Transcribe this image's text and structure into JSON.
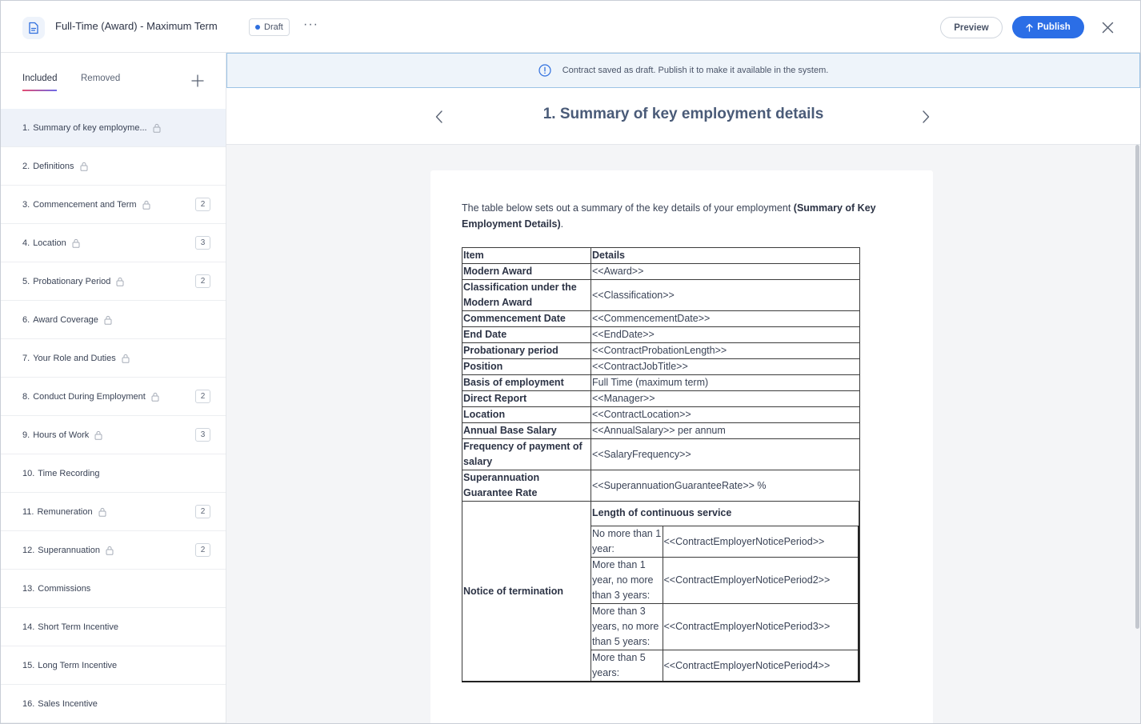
{
  "header": {
    "title": "Full-Time (Award) - Maximum Term",
    "status": "Draft",
    "more": "···",
    "preview_label": "Preview",
    "publish_label": "Publish"
  },
  "sidebar": {
    "tabs": [
      "Included",
      "Removed"
    ],
    "items": [
      {
        "num": "1.",
        "label": "Summary of key employme...",
        "lock": true,
        "count": ""
      },
      {
        "num": "2.",
        "label": "Definitions",
        "lock": true,
        "count": ""
      },
      {
        "num": "3.",
        "label": "Commencement and Term",
        "lock": true,
        "count": "2"
      },
      {
        "num": "4.",
        "label": "Location",
        "lock": true,
        "count": "3"
      },
      {
        "num": "5.",
        "label": "Probationary Period",
        "lock": true,
        "count": "2"
      },
      {
        "num": "6.",
        "label": "Award Coverage",
        "lock": true,
        "count": ""
      },
      {
        "num": "7.",
        "label": "Your Role and Duties",
        "lock": true,
        "count": ""
      },
      {
        "num": "8.",
        "label": "Conduct During Employment",
        "lock": true,
        "count": "2"
      },
      {
        "num": "9.",
        "label": "Hours of Work",
        "lock": true,
        "count": "3"
      },
      {
        "num": "10.",
        "label": "Time Recording",
        "lock": false,
        "count": ""
      },
      {
        "num": "11.",
        "label": "Remuneration",
        "lock": true,
        "count": "2"
      },
      {
        "num": "12.",
        "label": "Superannuation",
        "lock": true,
        "count": "2"
      },
      {
        "num": "13.",
        "label": "Commissions",
        "lock": false,
        "count": ""
      },
      {
        "num": "14.",
        "label": "Short Term Incentive",
        "lock": false,
        "count": ""
      },
      {
        "num": "15.",
        "label": "Long Term Incentive",
        "lock": false,
        "count": ""
      },
      {
        "num": "16.",
        "label": "Sales Incentive",
        "lock": false,
        "count": ""
      }
    ]
  },
  "banner": {
    "text": "Contract saved as draft. Publish it to make it available in the system."
  },
  "section": {
    "title": "1. Summary of key employment details",
    "intro_text": "The table below sets out a summary of the key details of your employment ",
    "intro_bold": "(Summary of Key Employment Details)",
    "intro_end": "."
  },
  "table": {
    "header": [
      "Item",
      "Details"
    ],
    "rows": [
      [
        "Modern Award",
        "<<Award>>"
      ],
      [
        "Classification under the Modern Award",
        "<<Classification>>"
      ],
      [
        "Commencement Date",
        "<<CommencementDate>>"
      ],
      [
        "End Date",
        "<<EndDate>>"
      ],
      [
        "Probationary period",
        "<<ContractProbationLength>>"
      ],
      [
        "Position",
        "<<ContractJobTitle>>"
      ],
      [
        "Basis of employment",
        "Full Time (maximum term)"
      ],
      [
        "Direct Report",
        "<<Manager>>"
      ],
      [
        "Location",
        "<<ContractLocation>>"
      ],
      [
        "Annual Base Salary",
        "<<AnnualSalary>> per annum"
      ],
      [
        "Frequency of payment of salary",
        "<<SalaryFrequency>>"
      ],
      [
        "Superannuation Guarantee Rate",
        "<<SuperannuationGuaranteeRate>> %"
      ]
    ],
    "notice": {
      "label": "Notice of termination",
      "subheader": "Length of continuous service",
      "rows": [
        [
          "No more than 1 year:",
          "<<ContractEmployerNoticePeriod>>"
        ],
        [
          "More than 1 year, no more than 3 years:",
          "<<ContractEmployerNoticePeriod2>>"
        ],
        [
          "More than 3 years, no more than 5 years:",
          "<<ContractEmployerNoticePeriod3>>"
        ],
        [
          "More than 5 years:",
          "<<ContractEmployerNoticePeriod4>>"
        ]
      ]
    }
  }
}
